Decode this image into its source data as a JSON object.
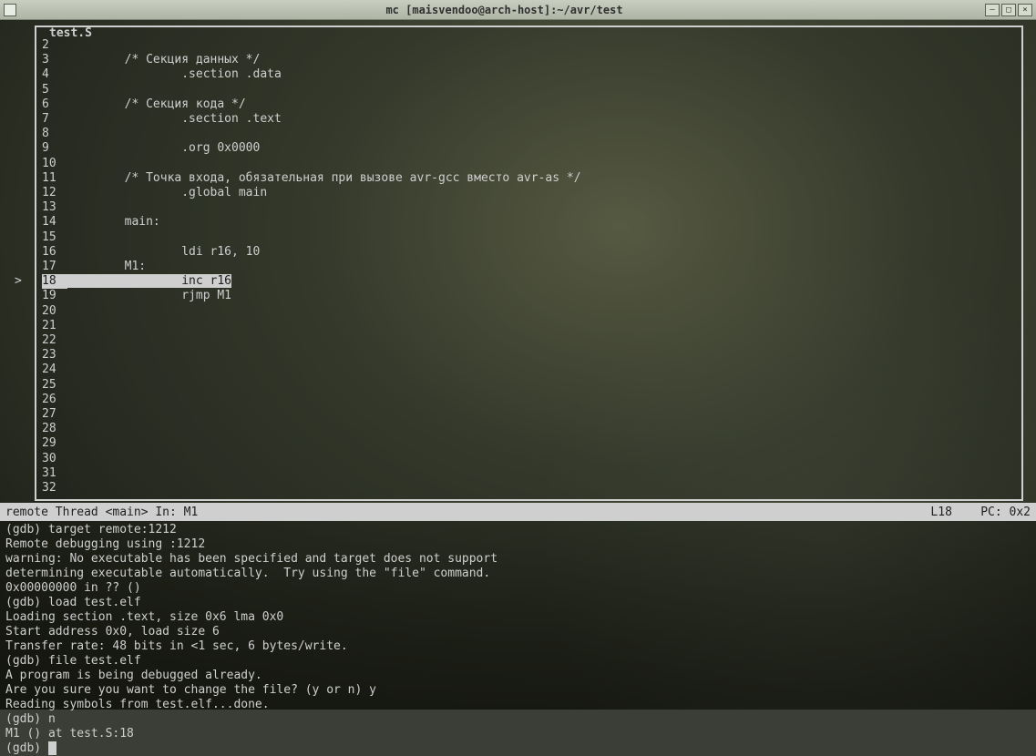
{
  "window": {
    "title": "mc [maisvendoo@arch-host]:~/avr/test"
  },
  "source": {
    "filename": "test.S",
    "current_line": 18,
    "lines": [
      {
        "n": 2,
        "text": ""
      },
      {
        "n": 3,
        "text": "        /* Секция данных */"
      },
      {
        "n": 4,
        "text": "                .section .data"
      },
      {
        "n": 5,
        "text": ""
      },
      {
        "n": 6,
        "text": "        /* Секция кода */"
      },
      {
        "n": 7,
        "text": "                .section .text"
      },
      {
        "n": 8,
        "text": ""
      },
      {
        "n": 9,
        "text": "                .org 0x0000"
      },
      {
        "n": 10,
        "text": ""
      },
      {
        "n": 11,
        "text": "        /* Точка входа, обязательная при вызове avr-gcc вместо avr-as */"
      },
      {
        "n": 12,
        "text": "                .global main"
      },
      {
        "n": 13,
        "text": ""
      },
      {
        "n": 14,
        "text": "        main:"
      },
      {
        "n": 15,
        "text": ""
      },
      {
        "n": 16,
        "text": "                ldi r16, 10"
      },
      {
        "n": 17,
        "text": "        M1:"
      },
      {
        "n": 18,
        "text": "                inc r16"
      },
      {
        "n": 19,
        "text": "                rjmp M1"
      },
      {
        "n": 20,
        "text": ""
      },
      {
        "n": 21,
        "text": ""
      },
      {
        "n": 22,
        "text": ""
      },
      {
        "n": 23,
        "text": ""
      },
      {
        "n": 24,
        "text": ""
      },
      {
        "n": 25,
        "text": ""
      },
      {
        "n": 26,
        "text": ""
      },
      {
        "n": 27,
        "text": ""
      },
      {
        "n": 28,
        "text": ""
      },
      {
        "n": 29,
        "text": ""
      },
      {
        "n": 30,
        "text": ""
      },
      {
        "n": 31,
        "text": ""
      },
      {
        "n": 32,
        "text": ""
      }
    ]
  },
  "status": {
    "left": "remote Thread <main> In: M1",
    "right": "L18    PC: 0x2"
  },
  "console": {
    "lines": [
      "(gdb) target remote:1212",
      "Remote debugging using :1212",
      "warning: No executable has been specified and target does not support",
      "determining executable automatically.  Try using the \"file\" command.",
      "0x00000000 in ?? ()",
      "(gdb) load test.elf",
      "Loading section .text, size 0x6 lma 0x0",
      "Start address 0x0, load size 6",
      "Transfer rate: 48 bits in <1 sec, 6 bytes/write.",
      "(gdb) file test.elf",
      "A program is being debugged already.",
      "Are you sure you want to change the file? (y or n) y",
      "Reading symbols from test.elf...done.",
      "(gdb) n",
      "M1 () at test.S:18"
    ],
    "prompt": "(gdb) "
  }
}
